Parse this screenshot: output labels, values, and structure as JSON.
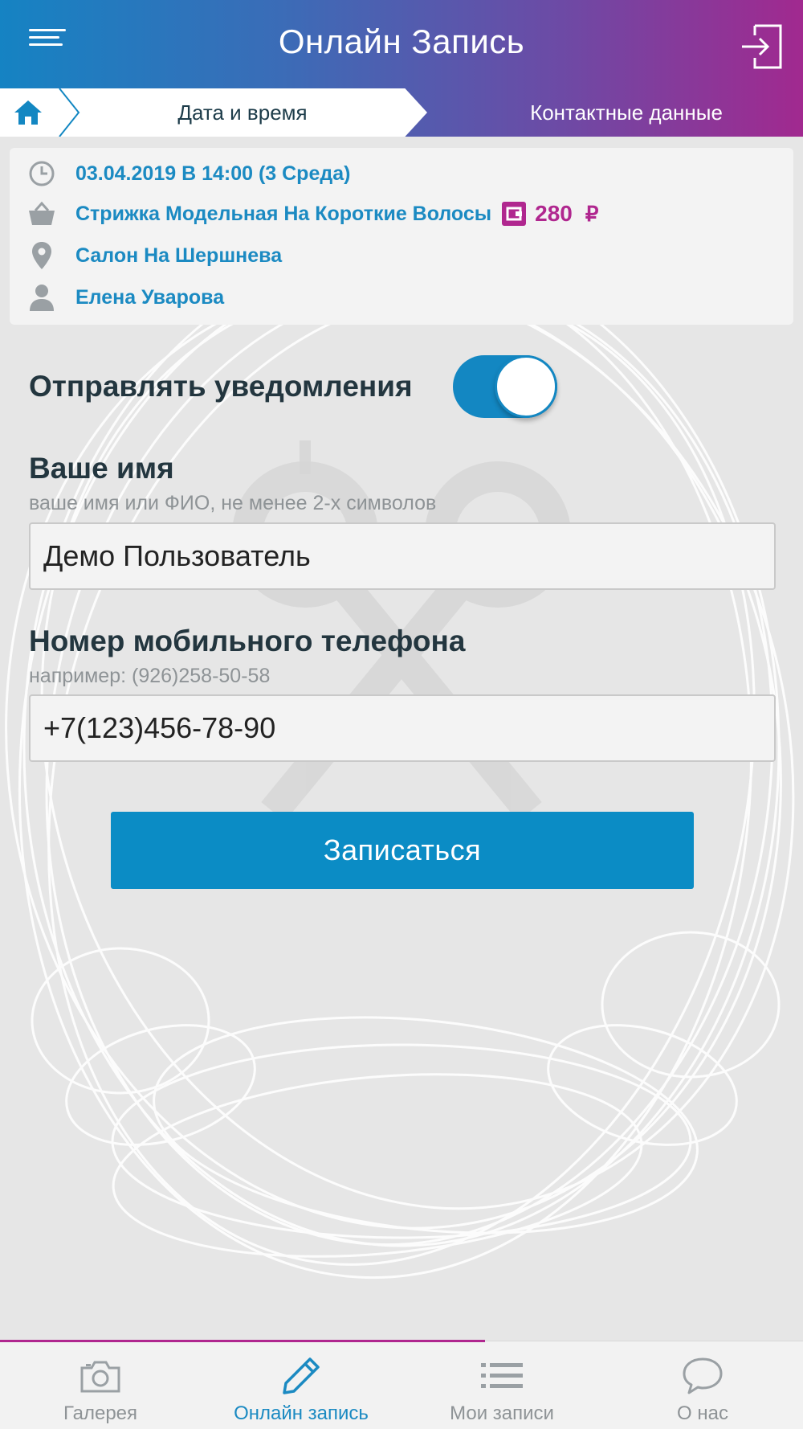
{
  "header": {
    "title": "Онлайн Запись"
  },
  "steps": {
    "date_time": "Дата и время",
    "contacts": "Контактные данные"
  },
  "summary": {
    "datetime": "03.04.2019 В 14:00 (3 Среда)",
    "service": "Стрижка Модельная На Короткие Волосы",
    "price": "280",
    "currency": "₽",
    "salon": "Салон На Шершнева",
    "master": "Елена Уварова"
  },
  "notifications": {
    "label": "Отправлять уведомления",
    "enabled": true
  },
  "form": {
    "name_title": "Ваше имя",
    "name_hint": "ваше имя или ФИО, не менее 2-х символов",
    "name_value": "Демо Пользователь",
    "phone_title": "Номер мобильного телефона",
    "phone_hint": "например: (926)258-50-58",
    "phone_value": "+7(123)456-78-90",
    "submit_label": "Записаться"
  },
  "tabbar": {
    "items": [
      {
        "label": "Галерея",
        "icon": "camera-icon",
        "active": false
      },
      {
        "label": "Онлайн запись",
        "icon": "pencil-icon",
        "active": true
      },
      {
        "label": "Мои записи",
        "icon": "list-icon",
        "active": false
      },
      {
        "label": "О нас",
        "icon": "chat-bubble-icon",
        "active": false
      }
    ]
  },
  "colors": {
    "accent_blue": "#1b8ac2",
    "accent_magenta": "#b0278f",
    "button_blue": "#0b8cc5",
    "text_dark": "#23363f"
  }
}
